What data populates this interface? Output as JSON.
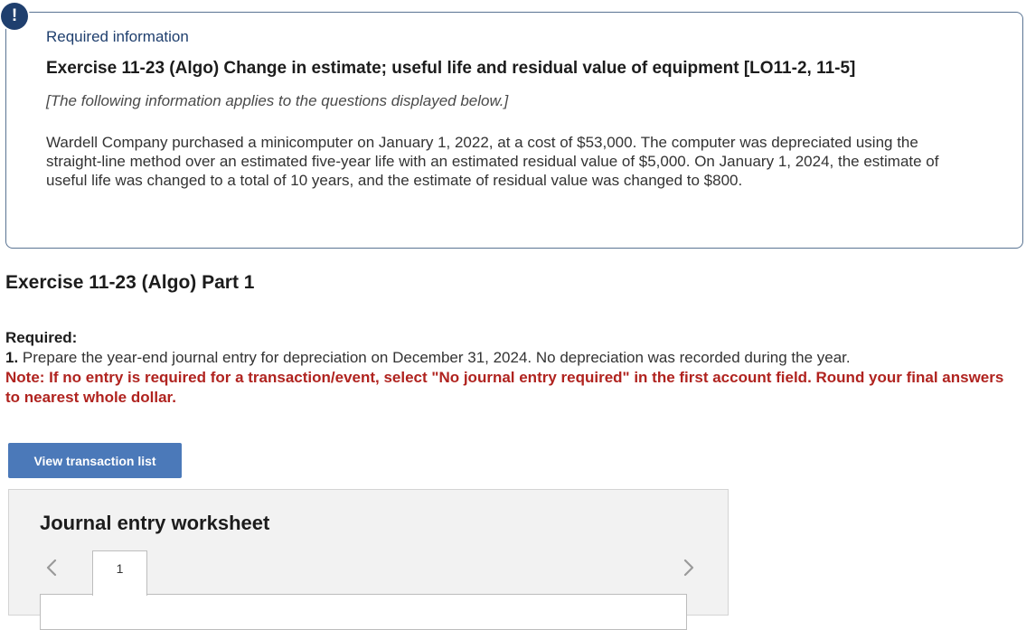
{
  "alert": {
    "icon": "!"
  },
  "info": {
    "heading": "Required information",
    "exercise_title": "Exercise 11-23 (Algo) Change in estimate; useful life and residual value of equipment [LO11-2, 11-5]",
    "applies_note": "[The following information applies to the questions displayed below.]",
    "body": "Wardell Company purchased a minicomputer on January 1, 2022, at a cost of $53,000. The computer was depreciated using the straight-line method over an estimated five-year life with an estimated residual value of $5,000. On January 1, 2024, the estimate of useful life was changed to a total of 10 years, and the estimate of residual value was changed to $800."
  },
  "part": {
    "title": "Exercise 11-23 (Algo) Part 1",
    "required_label": "Required:",
    "instruction_number": "1.",
    "instruction_text": " Prepare the year-end journal entry for depreciation on December 31, 2024. No depreciation was recorded during the year.",
    "note": "Note: If no entry is required for a transaction/event, select \"No journal entry required\" in the first account field. Round your final answers to nearest whole dollar."
  },
  "buttons": {
    "view_transactions": "View transaction list"
  },
  "worksheet": {
    "title": "Journal entry worksheet",
    "tabs": [
      "1"
    ],
    "prev_icon": "chevron-left-icon",
    "next_icon": "chevron-right-icon"
  },
  "colors": {
    "accent": "#1f3f6e",
    "button": "#4b79b9",
    "note_red": "#b0231f",
    "worksheet_bg": "#f2f2f2"
  }
}
